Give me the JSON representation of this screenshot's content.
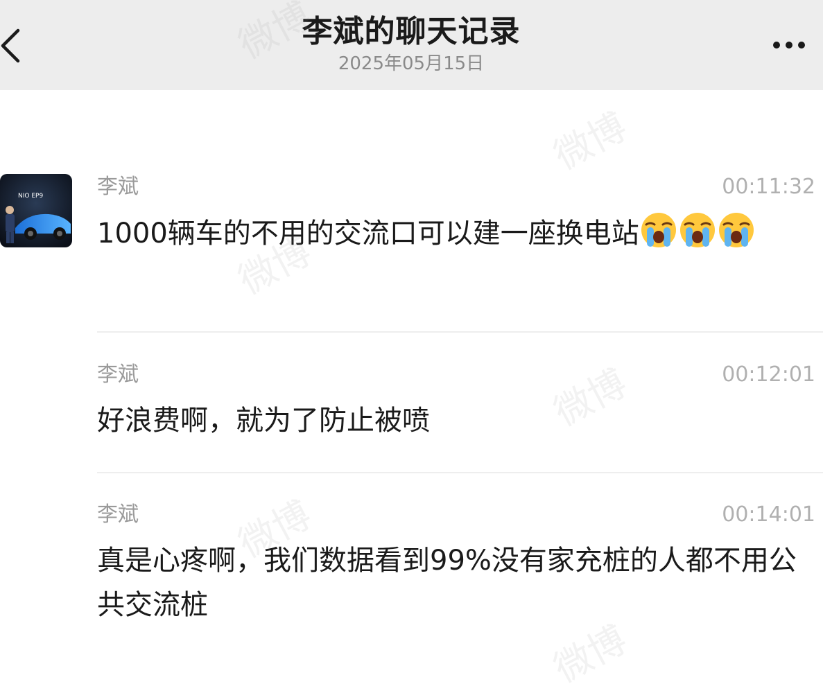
{
  "header": {
    "title": "李斌的聊天记录",
    "subtitle": "2025年05月15日"
  },
  "icons": {
    "back": "chevron-left-icon",
    "more": "more-horizontal-icon",
    "emoji": "loudly-crying-face-emoji"
  },
  "watermark": "微博",
  "messages": [
    {
      "sender": "李斌",
      "time": "00:11:32",
      "text": "1000辆车的不用的交流口可以建一座换电站",
      "emoji_count": 3
    },
    {
      "sender": "李斌",
      "time": "00:12:01",
      "text": "好浪费啊，就为了防止被喷"
    },
    {
      "sender": "李斌",
      "time": "00:14:01",
      "text": "真是心疼啊，我们数据看到99%没有家充桩的人都不用公共交流桩"
    }
  ]
}
